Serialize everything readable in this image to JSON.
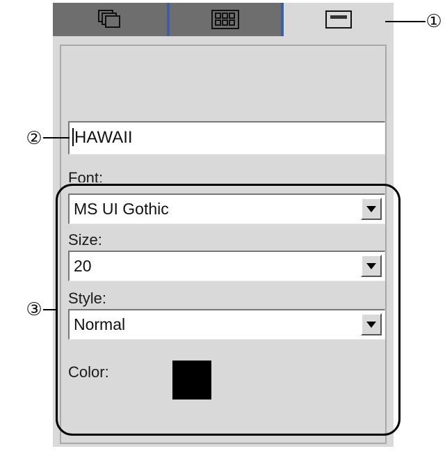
{
  "tabs": [
    {
      "icon": "layers-icon",
      "active": false
    },
    {
      "icon": "grid-icon",
      "active": false
    },
    {
      "icon": "text-frame-icon",
      "active": true
    }
  ],
  "text_field": {
    "value": "HAWAII"
  },
  "font": {
    "label": "Font:",
    "value": "MS UI Gothic"
  },
  "size": {
    "label": "Size:",
    "value": "20"
  },
  "style": {
    "label": "Style:",
    "value": "Normal"
  },
  "color": {
    "label": "Color:",
    "swatch": "#000000"
  },
  "callouts": {
    "c1": "①",
    "c2": "②",
    "c3": "③"
  },
  "colors": {
    "tab_inactive": "#6e6e6e",
    "tab_active": "#d9d9d9",
    "tab_divider": "#3d5f9f",
    "panel": "#d9d9d9"
  }
}
